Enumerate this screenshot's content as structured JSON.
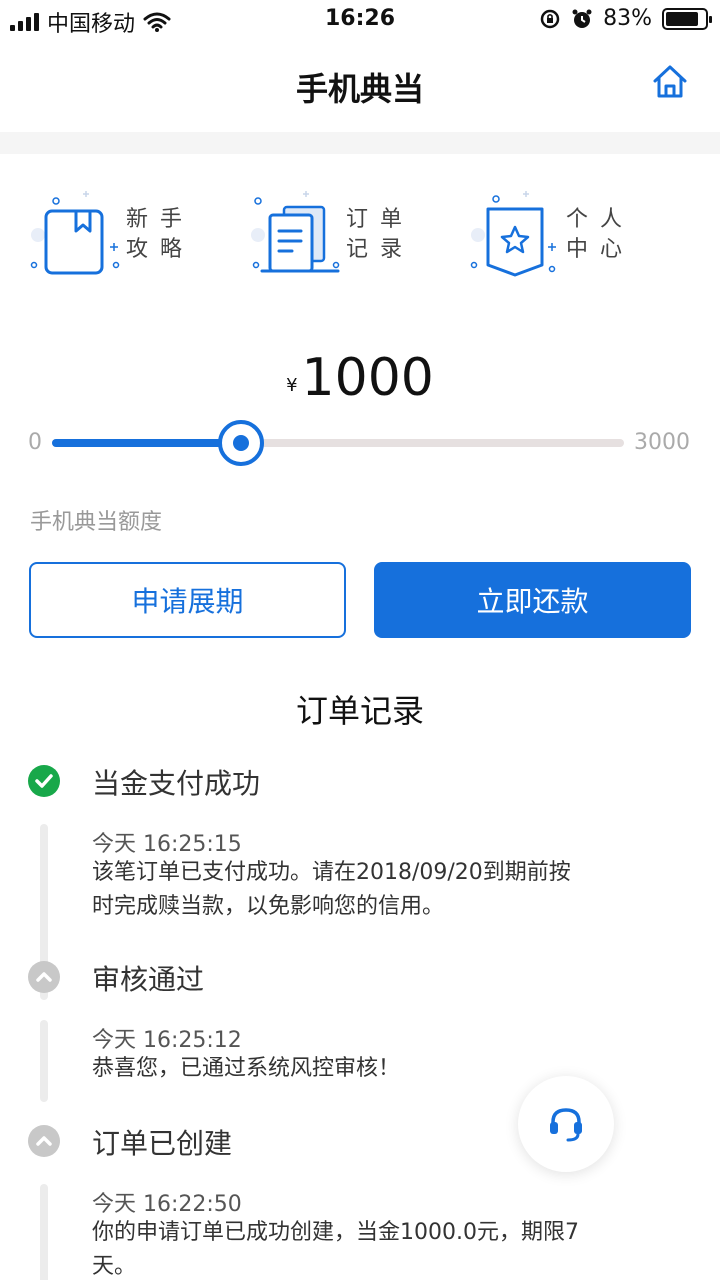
{
  "status_bar": {
    "carrier": "中国移动",
    "time": "16:26",
    "battery_text": "83%",
    "battery_level": 0.83
  },
  "nav": {
    "title": "手机典当",
    "home_icon": "home-icon"
  },
  "menu": [
    {
      "label_1": "新手",
      "label_2": "攻略",
      "icon": "book-icon"
    },
    {
      "label_1": "订单",
      "label_2": "记录",
      "icon": "document-icon"
    },
    {
      "label_1": "个人",
      "label_2": "中心",
      "icon": "star-badge-icon"
    }
  ],
  "amount": {
    "currency": "¥",
    "value": "1000"
  },
  "slider": {
    "min_label": "0",
    "max_label": "3000",
    "min": 0,
    "max": 3000,
    "value": 1000
  },
  "limit_label": "手机典当额度",
  "buttons": {
    "extend": "申请展期",
    "repay": "立即还款"
  },
  "order_records": {
    "title": "订单记录",
    "items": [
      {
        "title": "当金支付成功",
        "status": "success",
        "time": "今天 16:25:15",
        "desc": "该笔订单已支付成功。请在2018/09/20到期前按时完成赎当款，以免影响您的信用。"
      },
      {
        "title": "审核通过",
        "status": "done",
        "time": "今天 16:25:12",
        "desc": "恭喜您，已通过系统风控审核！"
      },
      {
        "title": "订单已创建",
        "status": "done",
        "time": "今天 16:22:50",
        "desc": "你的申请订单已成功创建，当金1000.0元，期限7天。"
      }
    ]
  },
  "colors": {
    "accent": "#1670dc",
    "success": "#18a84a",
    "muted_dot": "#c8c8c8"
  }
}
